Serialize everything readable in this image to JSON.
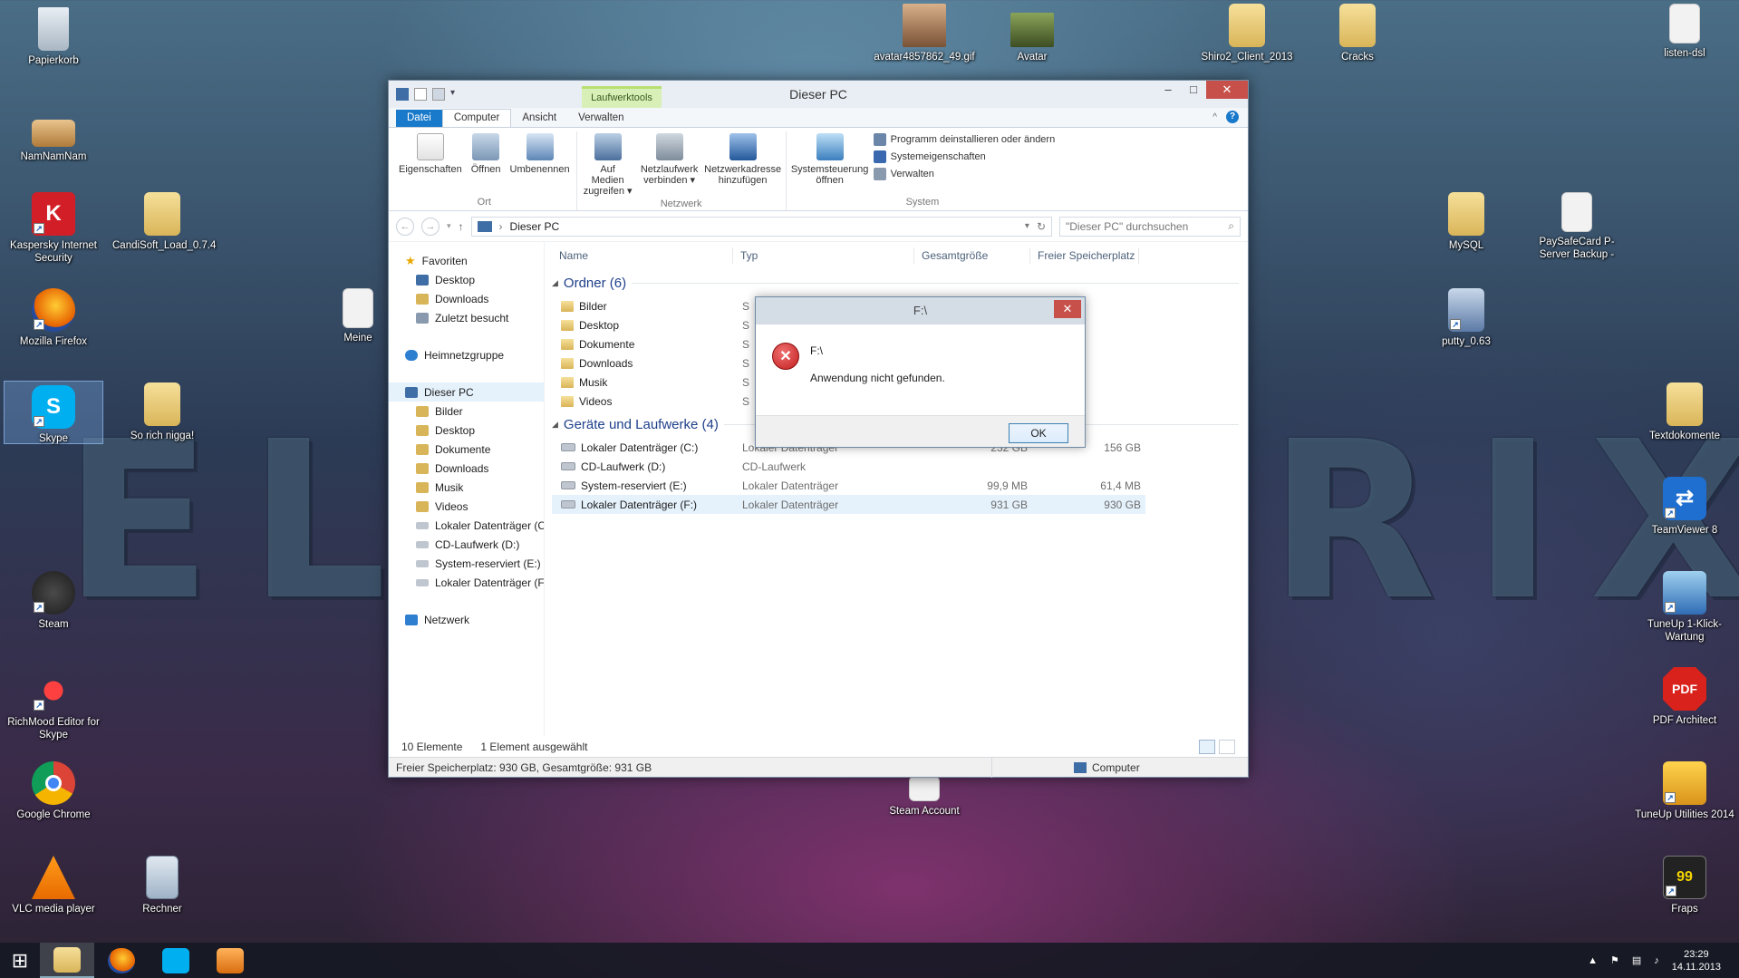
{
  "desktop": {
    "wallpaper_text_left": "EL",
    "wallpaper_text_right": "RIX",
    "icons_left": [
      {
        "label": "Papierkorb",
        "icon": "recycle-bin-icon"
      },
      {
        "label": "NamNamNam",
        "icon": "package-icon"
      },
      {
        "label": "Kaspersky Internet Security",
        "icon": "kaspersky-icon"
      },
      {
        "label": "CandiSoft_Load_0.7.4",
        "icon": "folder-icon"
      },
      {
        "label": "Mozilla Firefox",
        "icon": "firefox-icon"
      },
      {
        "label": "Meine",
        "icon": "document-icon"
      },
      {
        "label": "Skype",
        "icon": "skype-icon"
      },
      {
        "label": "So rich nigga!",
        "icon": "folder-icon"
      },
      {
        "label": "Steam",
        "icon": "steam-icon"
      },
      {
        "label": "RichMood Editor for Skype",
        "icon": "richmood-icon"
      },
      {
        "label": "Google Chrome",
        "icon": "chrome-icon"
      },
      {
        "label": "VLC media player",
        "icon": "vlc-icon"
      },
      {
        "label": "Rechner",
        "icon": "calculator-icon"
      }
    ],
    "icons_top": [
      {
        "label": "avatar4857862_49.gif",
        "icon": "image-icon"
      },
      {
        "label": "Avatar",
        "icon": "image-icon"
      },
      {
        "label": "Shiro2_Client_2013",
        "icon": "folder-icon"
      },
      {
        "label": "Cracks",
        "icon": "folder-icon"
      },
      {
        "label": "listen-dsl",
        "icon": "document-icon"
      }
    ],
    "icons_right": [
      {
        "label": "MySQL",
        "icon": "folder-icon"
      },
      {
        "label": "PaySafeCard P-Server Backup -",
        "icon": "document-icon"
      },
      {
        "label": "putty_0.63",
        "icon": "putty-icon"
      },
      {
        "label": "Textdokomente",
        "icon": "folder-icon"
      },
      {
        "label": "TeamViewer 8",
        "icon": "teamviewer-icon"
      },
      {
        "label": "TuneUp 1-Klick-Wartung",
        "icon": "tuneup-icon"
      },
      {
        "label": "PDF Architect",
        "icon": "pdf-icon"
      },
      {
        "label": "TuneUp Utilities 2014",
        "icon": "tuneup-icon"
      },
      {
        "label": "Fraps",
        "icon": "fraps-icon"
      },
      {
        "label": "Steam Account",
        "icon": "document-icon"
      }
    ]
  },
  "explorer": {
    "title": "Dieser PC",
    "context_tab": "Laufwerktools",
    "tabs": [
      "Datei",
      "Computer",
      "Ansicht",
      "Verwalten"
    ],
    "ribbon": {
      "ort": {
        "name": "Ort",
        "buttons": [
          "Eigenschaften",
          "Öffnen",
          "Umbenennen"
        ]
      },
      "netzwerk": {
        "name": "Netzwerk",
        "buttons": [
          "Auf Medien zugreifen ▾",
          "Netzlaufwerk verbinden ▾",
          "Netzwerkadresse hinzufügen"
        ]
      },
      "system": {
        "name": "System",
        "big_button": "Systemsteuerung öffnen",
        "small": [
          "Programm deinstallieren oder ändern",
          "Systemeigenschaften",
          "Verwalten"
        ]
      }
    },
    "address": "Dieser PC",
    "search_placeholder": "\"Dieser PC\" durchsuchen",
    "nav": {
      "favoriten": "Favoriten",
      "fav_items": [
        "Desktop",
        "Downloads",
        "Zuletzt besucht"
      ],
      "heimnetzgruppe": "Heimnetzgruppe",
      "dieser_pc": "Dieser PC",
      "pc_items": [
        "Bilder",
        "Desktop",
        "Dokumente",
        "Downloads",
        "Musik",
        "Videos",
        "Lokaler Datenträger (C",
        "CD-Laufwerk (D:)",
        "System-reserviert (E:)",
        "Lokaler Datenträger (F:"
      ],
      "netzwerk": "Netzwerk"
    },
    "columns": [
      "Name",
      "Typ",
      "Gesamtgröße",
      "Freier Speicherplatz"
    ],
    "folders_group": "Ordner (6)",
    "folders": [
      {
        "name": "Bilder",
        "type": "S"
      },
      {
        "name": "Desktop",
        "type": "S"
      },
      {
        "name": "Dokumente",
        "type": "S"
      },
      {
        "name": "Downloads",
        "type": "S"
      },
      {
        "name": "Musik",
        "type": "S"
      },
      {
        "name": "Videos",
        "type": "S"
      }
    ],
    "drives_group": "Geräte und Laufwerke (4)",
    "drives": [
      {
        "name": "Lokaler Datenträger (C:)",
        "type": "Lokaler Datenträger",
        "size": "232 GB",
        "free": "156 GB"
      },
      {
        "name": "CD-Laufwerk (D:)",
        "type": "CD-Laufwerk",
        "size": "",
        "free": ""
      },
      {
        "name": "System-reserviert (E:)",
        "type": "Lokaler Datenträger",
        "size": "99,9 MB",
        "free": "61,4 MB"
      },
      {
        "name": "Lokaler Datenträger (F:)",
        "type": "Lokaler Datenträger",
        "size": "931 GB",
        "free": "930 GB"
      }
    ],
    "status_count": "10 Elemente",
    "status_selected": "1 Element ausgewählt",
    "statusbar_left": "Freier Speicherplatz: 930 GB, Gesamtgröße: 931 GB",
    "statusbar_right": "Computer"
  },
  "dialog": {
    "title": "F:\\",
    "path": "F:\\",
    "message": "Anwendung nicht gefunden.",
    "ok": "OK"
  },
  "taskbar": {
    "time": "23:29",
    "date": "14.11.2013"
  }
}
